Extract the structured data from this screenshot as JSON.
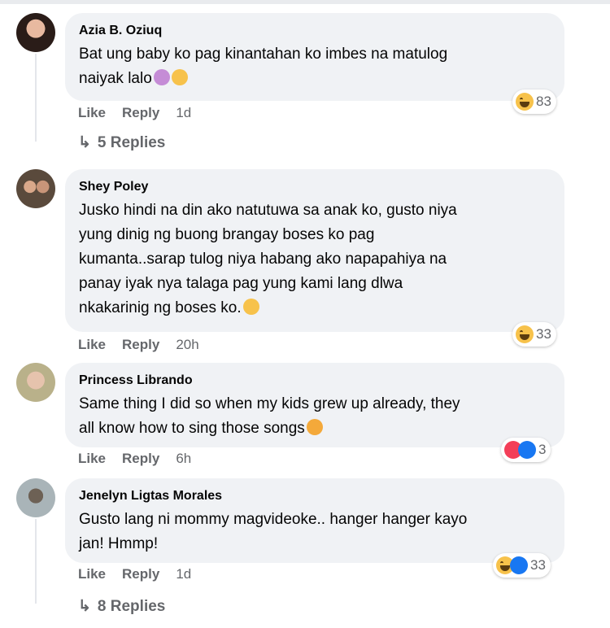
{
  "comments": [
    {
      "author": "Azia B. Oziuq",
      "text": "Bat ung baby ko pag kinantahan ko imbes na matulog\nnaiyak lalo",
      "like": "Like",
      "reply": "Reply",
      "time": "1d",
      "reaction_count": "83",
      "replies": "5 Replies"
    },
    {
      "author": "Shey Poley",
      "text": "Jusko hindi na din ako natutuwa sa anak ko, gusto niya\nyung dinig ng buong brangay boses ko pag\nkumanta..sarap tulog niya habang ako napapahiya na\npanay iyak nya talaga pag yung kami lang dlwa\nnkakarinig ng boses ko.",
      "like": "Like",
      "reply": "Reply",
      "time": "20h",
      "reaction_count": "33"
    },
    {
      "author": "Princess Librando",
      "text": "Same thing I did so when my kids grew up already, they\nall know how to sing those songs",
      "like": "Like",
      "reply": "Reply",
      "time": "6h",
      "reaction_count": "3"
    },
    {
      "author": "Jenelyn Ligtas Morales",
      "text": "Gusto lang ni mommy magvideoke.. hanger hanger kayo\njan! Hmmp!",
      "like": "Like",
      "reply": "Reply",
      "time": "1d",
      "reaction_count": "33",
      "replies": "8 Replies"
    }
  ]
}
